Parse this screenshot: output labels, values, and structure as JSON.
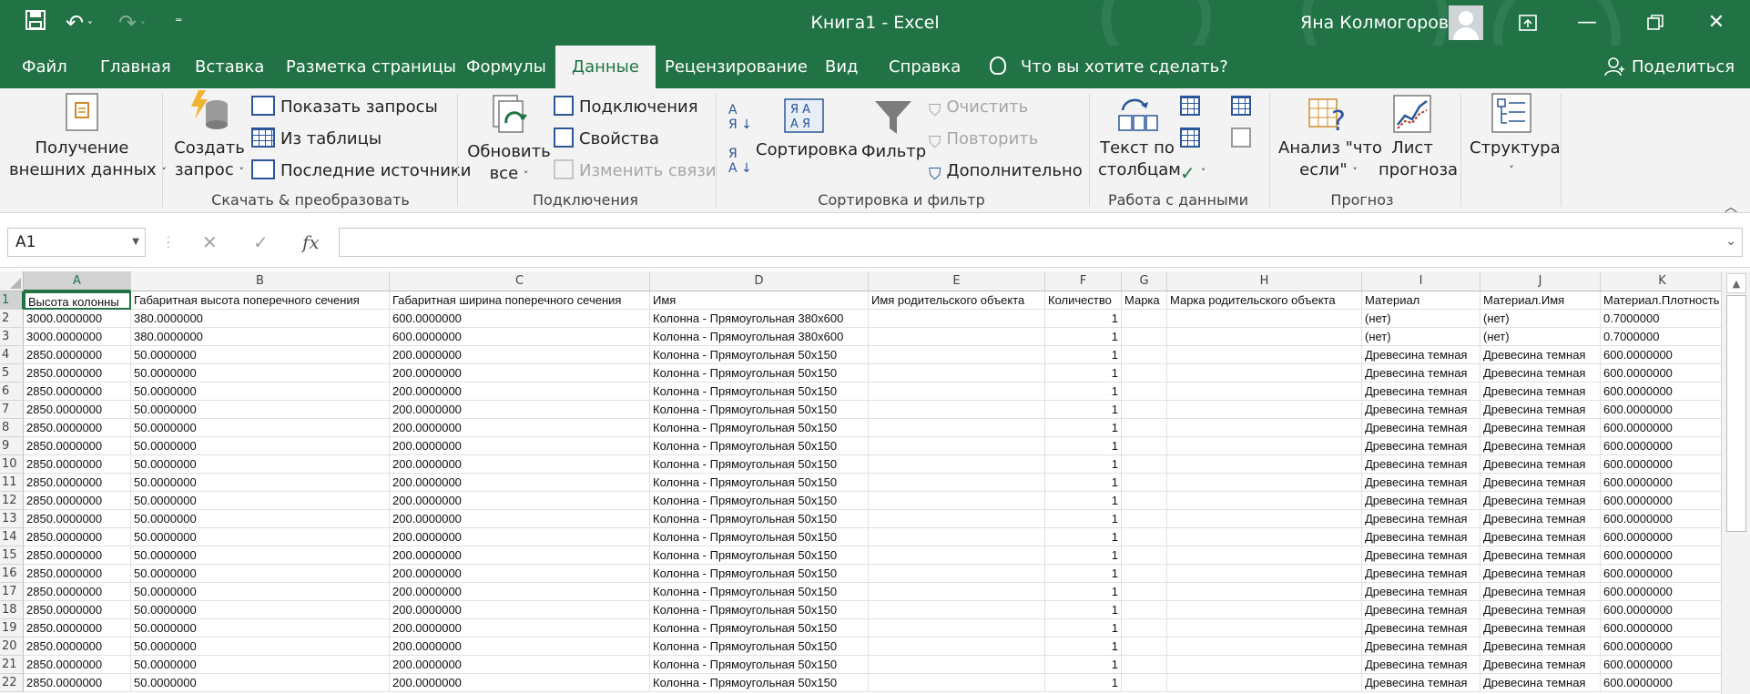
{
  "titlebar": {
    "title": "Книга1  -  Excel",
    "user": "Яна Колмогорова"
  },
  "tabs": [
    "Файл",
    "Главная",
    "Вставка",
    "Разметка страницы",
    "Формулы",
    "Данные",
    "Рецензирование",
    "Вид",
    "Справка"
  ],
  "active_tab": "Данные",
  "tell_me": "Что вы хотите сделать?",
  "share": "Поделиться",
  "ribbon": {
    "get_external": {
      "line1": "Получение",
      "line2": "внешних данных"
    },
    "create_query": {
      "line1": "Создать",
      "line2": "запрос"
    },
    "show_queries": "Показать запросы",
    "from_table": "Из таблицы",
    "recent_sources": "Последние источники",
    "group_get_transform": "Скачать & преобразовать",
    "refresh_all": {
      "line1": "Обновить",
      "line2": "все"
    },
    "connections": "Подключения",
    "properties": "Свойства",
    "edit_links": "Изменить связи",
    "group_connections": "Подключения",
    "sort": "Сортировка",
    "filter": "Фильтр",
    "clear": "Очистить",
    "reapply": "Повторить",
    "advanced": "Дополнительно",
    "group_sort_filter": "Сортировка и фильтр",
    "text_to_columns": {
      "line1": "Текст по",
      "line2": "столбцам"
    },
    "group_data_tools": "Работа с данными",
    "what_if": {
      "line1": "Анализ \"что",
      "line2": "если\""
    },
    "forecast_sheet": {
      "line1": "Лист",
      "line2": "прогноза"
    },
    "group_forecast": "Прогноз",
    "outline": "Структура"
  },
  "formula_bar": {
    "name_box": "A1",
    "cancel": "✕",
    "enter": "✓",
    "fx": "fx",
    "formula": ""
  },
  "sheet": {
    "columns": [
      "A",
      "B",
      "C",
      "D",
      "E",
      "F",
      "G",
      "H",
      "I",
      "J",
      "K"
    ],
    "header_row": [
      "Высота колонны",
      "Габаритная высота поперечного сечения",
      "Габаритная ширина поперечного сечения",
      "Имя",
      "Имя родительского объекта",
      "Количество",
      "Марка",
      "Марка родительского объекта",
      "Материал",
      "Материал.Имя",
      "Материал.Плотность"
    ],
    "rows": [
      [
        "3000.0000000",
        "380.0000000",
        "600.0000000",
        "Колонна - Прямоугольная 380x600",
        "",
        "1",
        "",
        "",
        "(нет)",
        "(нет)",
        "0.7000000"
      ],
      [
        "3000.0000000",
        "380.0000000",
        "600.0000000",
        "Колонна - Прямоугольная 380x600",
        "",
        "1",
        "",
        "",
        "(нет)",
        "(нет)",
        "0.7000000"
      ],
      [
        "2850.0000000",
        "50.0000000",
        "200.0000000",
        "Колонна - Прямоугольная 50x150",
        "",
        "1",
        "",
        "",
        "Древесина темная",
        "Древесина темная",
        "600.0000000"
      ],
      [
        "2850.0000000",
        "50.0000000",
        "200.0000000",
        "Колонна - Прямоугольная 50x150",
        "",
        "1",
        "",
        "",
        "Древесина темная",
        "Древесина темная",
        "600.0000000"
      ],
      [
        "2850.0000000",
        "50.0000000",
        "200.0000000",
        "Колонна - Прямоугольная 50x150",
        "",
        "1",
        "",
        "",
        "Древесина темная",
        "Древесина темная",
        "600.0000000"
      ],
      [
        "2850.0000000",
        "50.0000000",
        "200.0000000",
        "Колонна - Прямоугольная 50x150",
        "",
        "1",
        "",
        "",
        "Древесина темная",
        "Древесина темная",
        "600.0000000"
      ],
      [
        "2850.0000000",
        "50.0000000",
        "200.0000000",
        "Колонна - Прямоугольная 50x150",
        "",
        "1",
        "",
        "",
        "Древесина темная",
        "Древесина темная",
        "600.0000000"
      ],
      [
        "2850.0000000",
        "50.0000000",
        "200.0000000",
        "Колонна - Прямоугольная 50x150",
        "",
        "1",
        "",
        "",
        "Древесина темная",
        "Древесина темная",
        "600.0000000"
      ],
      [
        "2850.0000000",
        "50.0000000",
        "200.0000000",
        "Колонна - Прямоугольная 50x150",
        "",
        "1",
        "",
        "",
        "Древесина темная",
        "Древесина темная",
        "600.0000000"
      ],
      [
        "2850.0000000",
        "50.0000000",
        "200.0000000",
        "Колонна - Прямоугольная 50x150",
        "",
        "1",
        "",
        "",
        "Древесина темная",
        "Древесина темная",
        "600.0000000"
      ],
      [
        "2850.0000000",
        "50.0000000",
        "200.0000000",
        "Колонна - Прямоугольная 50x150",
        "",
        "1",
        "",
        "",
        "Древесина темная",
        "Древесина темная",
        "600.0000000"
      ],
      [
        "2850.0000000",
        "50.0000000",
        "200.0000000",
        "Колонна - Прямоугольная 50x150",
        "",
        "1",
        "",
        "",
        "Древесина темная",
        "Древесина темная",
        "600.0000000"
      ],
      [
        "2850.0000000",
        "50.0000000",
        "200.0000000",
        "Колонна - Прямоугольная 50x150",
        "",
        "1",
        "",
        "",
        "Древесина темная",
        "Древесина темная",
        "600.0000000"
      ],
      [
        "2850.0000000",
        "50.0000000",
        "200.0000000",
        "Колонна - Прямоугольная 50x150",
        "",
        "1",
        "",
        "",
        "Древесина темная",
        "Древесина темная",
        "600.0000000"
      ],
      [
        "2850.0000000",
        "50.0000000",
        "200.0000000",
        "Колонна - Прямоугольная 50x150",
        "",
        "1",
        "",
        "",
        "Древесина темная",
        "Древесина темная",
        "600.0000000"
      ],
      [
        "2850.0000000",
        "50.0000000",
        "200.0000000",
        "Колонна - Прямоугольная 50x150",
        "",
        "1",
        "",
        "",
        "Древесина темная",
        "Древесина темная",
        "600.0000000"
      ],
      [
        "2850.0000000",
        "50.0000000",
        "200.0000000",
        "Колонна - Прямоугольная 50x150",
        "",
        "1",
        "",
        "",
        "Древесина темная",
        "Древесина темная",
        "600.0000000"
      ],
      [
        "2850.0000000",
        "50.0000000",
        "200.0000000",
        "Колонна - Прямоугольная 50x150",
        "",
        "1",
        "",
        "",
        "Древесина темная",
        "Древесина темная",
        "600.0000000"
      ],
      [
        "2850.0000000",
        "50.0000000",
        "200.0000000",
        "Колонна - Прямоугольная 50x150",
        "",
        "1",
        "",
        "",
        "Древесина темная",
        "Древесина темная",
        "600.0000000"
      ],
      [
        "2850.0000000",
        "50.0000000",
        "200.0000000",
        "Колонна - Прямоугольная 50x150",
        "",
        "1",
        "",
        "",
        "Древесина темная",
        "Древесина темная",
        "600.0000000"
      ],
      [
        "2850.0000000",
        "50.0000000",
        "200.0000000",
        "Колонна - Прямоугольная 50x150",
        "",
        "1",
        "",
        "",
        "Древесина темная",
        "Древесина темная",
        "600.0000000"
      ]
    ],
    "row_numbers": [
      "1",
      "2",
      "3",
      "4",
      "5",
      "6",
      "7",
      "8",
      "9",
      "10",
      "11",
      "12",
      "13",
      "14",
      "15",
      "16",
      "17",
      "18",
      "19",
      "20",
      "21",
      "22"
    ],
    "numeric_columns": [
      5
    ],
    "active_cell": "A1"
  },
  "colors": {
    "brand": "#217346",
    "ribbon_bg": "#f3f3f3",
    "accent_blue": "#2b579a"
  },
  "icons": {
    "save": "save-icon",
    "undo": "undo-icon",
    "redo": "redo-icon",
    "customize": "customize-qat-icon",
    "ribbon_display": "ribbon-display-icon",
    "minimize": "minimize-icon",
    "restore": "restore-icon",
    "close": "close-icon",
    "lightbulb": "lightbulb-icon",
    "share": "share-person-icon"
  }
}
